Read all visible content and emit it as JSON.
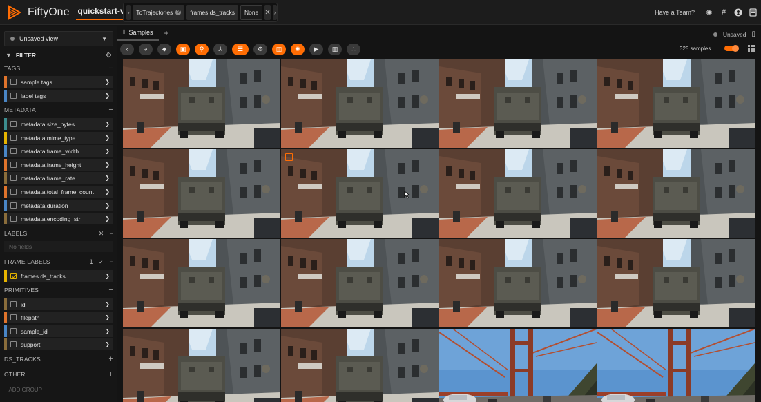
{
  "app": {
    "brand": "FiftyOne",
    "dataset": "quickstart-video",
    "view_stages": [
      {
        "label": "ToTrajectories",
        "has_info": true
      },
      {
        "label": "frames.ds_tracks"
      },
      {
        "label": "None"
      }
    ],
    "team_link": "Have a Team?",
    "header_icons": [
      "theme-icon",
      "slack-icon",
      "github-icon",
      "docs-icon"
    ]
  },
  "sidebar": {
    "view_select": "Unsaved view",
    "filter_title": "FILTER",
    "sections": {
      "tags": {
        "title": "TAGS",
        "items": [
          {
            "label": "sample tags",
            "color": "#e0742c"
          },
          {
            "label": "label tags",
            "color": "#4a86c5"
          }
        ]
      },
      "metadata": {
        "title": "METADATA",
        "items": [
          {
            "label": "metadata.size_bytes",
            "color": "#3c8d8f"
          },
          {
            "label": "metadata.mime_type",
            "color": "#e6b400"
          },
          {
            "label": "metadata.frame_width",
            "color": "#4a86c5"
          },
          {
            "label": "metadata.frame_height",
            "color": "#e0742c"
          },
          {
            "label": "metadata.frame_rate",
            "color": "#8a6d3b"
          },
          {
            "label": "metadata.total_frame_count",
            "color": "#e0742c"
          },
          {
            "label": "metadata.duration",
            "color": "#4a86c5"
          },
          {
            "label": "metadata.encoding_str",
            "color": "#8a6d3b"
          }
        ]
      },
      "labels": {
        "title": "LABELS",
        "empty": "No fields"
      },
      "frame_labels": {
        "title": "FRAME LABELS",
        "count": "1",
        "items": [
          {
            "label": "frames.ds_tracks",
            "color": "#e6b400",
            "checked": true
          }
        ]
      },
      "primitives": {
        "title": "PRIMITIVES",
        "items": [
          {
            "label": "id",
            "color": "#8a6d3b"
          },
          {
            "label": "filepath",
            "color": "#e0742c"
          },
          {
            "label": "sample_id",
            "color": "#4a86c5"
          },
          {
            "label": "support",
            "color": "#8a6d3b"
          }
        ]
      },
      "ds_tracks": {
        "title": "DS_TRACKS"
      },
      "other": {
        "title": "OTHER"
      }
    },
    "add_group": "+ ADD GROUP"
  },
  "samples": {
    "tab_label": "Samples",
    "status": "Unsaved",
    "count_text": "325 samples",
    "toolbar_buttons": [
      {
        "name": "back-button-icon",
        "active": false
      },
      {
        "name": "color-palette-icon",
        "active": false
      },
      {
        "name": "tag-icon",
        "active": false
      },
      {
        "name": "patches-icon",
        "active": true
      },
      {
        "name": "search-icon",
        "active": true
      },
      {
        "name": "similarity-icon",
        "active": false
      },
      {
        "name": "operators-icon",
        "active": true
      },
      {
        "name": "settings-icon",
        "active": false
      },
      {
        "name": "embeddings-icon",
        "active": true
      },
      {
        "name": "brain-icon",
        "active": true
      },
      {
        "name": "video-icon",
        "active": false
      },
      {
        "name": "histogram-icon",
        "active": false
      },
      {
        "name": "scatter-icon",
        "active": false
      }
    ],
    "thumbnails": [
      "street",
      "street",
      "street",
      "street",
      "street",
      "street",
      "street",
      "street",
      "street",
      "street",
      "street",
      "street",
      "street",
      "street",
      "bridge",
      "bridge"
    ]
  },
  "colors": {
    "accent": "#ff6d04",
    "background": "#141414"
  }
}
